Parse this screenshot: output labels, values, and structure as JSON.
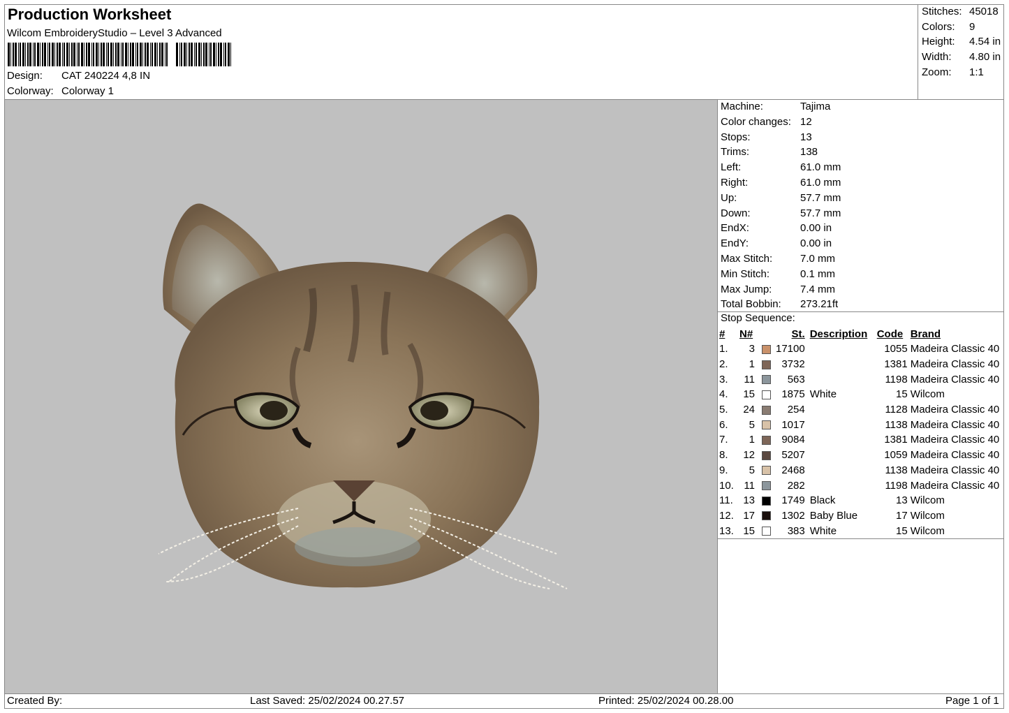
{
  "header": {
    "title": "Production Worksheet",
    "software": "Wilcom EmbroideryStudio – Level 3 Advanced",
    "design_label": "Design:",
    "design_value": "CAT 240224 4,8 IN",
    "colorway_label": "Colorway:",
    "colorway_value": "Colorway 1"
  },
  "summary": {
    "stitches_label": "Stitches:",
    "stitches": "45018",
    "colors_label": "Colors:",
    "colors": "9",
    "height_label": "Height:",
    "height": "4.54 in",
    "width_label": "Width:",
    "width": "4.80 in",
    "zoom_label": "Zoom:",
    "zoom": "1:1"
  },
  "machine_info": [
    {
      "label": "Machine:",
      "value": "Tajima"
    },
    {
      "label": "Color changes:",
      "value": "12"
    },
    {
      "label": "Stops:",
      "value": "13"
    },
    {
      "label": "Trims:",
      "value": "138"
    },
    {
      "label": "Left:",
      "value": "61.0 mm"
    },
    {
      "label": "Right:",
      "value": "61.0 mm"
    },
    {
      "label": "Up:",
      "value": "57.7 mm"
    },
    {
      "label": "Down:",
      "value": "57.7 mm"
    },
    {
      "label": "EndX:",
      "value": "0.00 in"
    },
    {
      "label": "EndY:",
      "value": "0.00 in"
    },
    {
      "label": "Max Stitch:",
      "value": "7.0 mm"
    },
    {
      "label": "Min Stitch:",
      "value": "0.1 mm"
    },
    {
      "label": "Max Jump:",
      "value": "7.4 mm"
    },
    {
      "label": "Total Bobbin:",
      "value": "273.21ft"
    }
  ],
  "stop_sequence": {
    "title": "Stop Sequence:",
    "headers": [
      "#",
      "N#",
      "St.",
      "Description",
      "Code",
      "Brand"
    ],
    "rows": [
      {
        "num": "1.",
        "n": "3",
        "color": "#c9916a",
        "st": "17100",
        "desc": "",
        "code": "1055",
        "brand": "Madeira Classic 40"
      },
      {
        "num": "2.",
        "n": "1",
        "color": "#7e6658",
        "st": "3732",
        "desc": "",
        "code": "1381",
        "brand": "Madeira Classic 40"
      },
      {
        "num": "3.",
        "n": "11",
        "color": "#8c969c",
        "st": "563",
        "desc": "",
        "code": "1198",
        "brand": "Madeira Classic 40"
      },
      {
        "num": "4.",
        "n": "15",
        "color": "#ffffff",
        "st": "1875",
        "desc": "White",
        "code": "15",
        "brand": "Wilcom"
      },
      {
        "num": "5.",
        "n": "24",
        "color": "#8a7c72",
        "st": "254",
        "desc": "",
        "code": "1128",
        "brand": "Madeira Classic 40"
      },
      {
        "num": "6.",
        "n": "5",
        "color": "#d8c2a8",
        "st": "1017",
        "desc": "",
        "code": "1138",
        "brand": "Madeira Classic 40"
      },
      {
        "num": "7.",
        "n": "1",
        "color": "#7e6658",
        "st": "9084",
        "desc": "",
        "code": "1381",
        "brand": "Madeira Classic 40"
      },
      {
        "num": "8.",
        "n": "12",
        "color": "#5a4840",
        "st": "5207",
        "desc": "",
        "code": "1059",
        "brand": "Madeira Classic 40"
      },
      {
        "num": "9.",
        "n": "5",
        "color": "#d8c2a8",
        "st": "2468",
        "desc": "",
        "code": "1138",
        "brand": "Madeira Classic 40"
      },
      {
        "num": "10.",
        "n": "11",
        "color": "#8c969c",
        "st": "282",
        "desc": "",
        "code": "1198",
        "brand": "Madeira Classic 40"
      },
      {
        "num": "11.",
        "n": "13",
        "color": "#000000",
        "st": "1749",
        "desc": "Black",
        "code": "13",
        "brand": "Wilcom"
      },
      {
        "num": "12.",
        "n": "17",
        "color": "#1a0f0c",
        "st": "1302",
        "desc": "Baby Blue",
        "code": "17",
        "brand": "Wilcom"
      },
      {
        "num": "13.",
        "n": "15",
        "color": "#ffffff",
        "st": "383",
        "desc": "White",
        "code": "15",
        "brand": "Wilcom"
      }
    ]
  },
  "footer": {
    "created_by": "Created By:",
    "last_saved": "Last Saved: 25/02/2024 00.27.57",
    "printed": "Printed: 25/02/2024 00.28.00",
    "page": "Page 1 of 1"
  },
  "preview": {
    "background": "#c0c0c0",
    "subject": "embroidered cat face"
  }
}
